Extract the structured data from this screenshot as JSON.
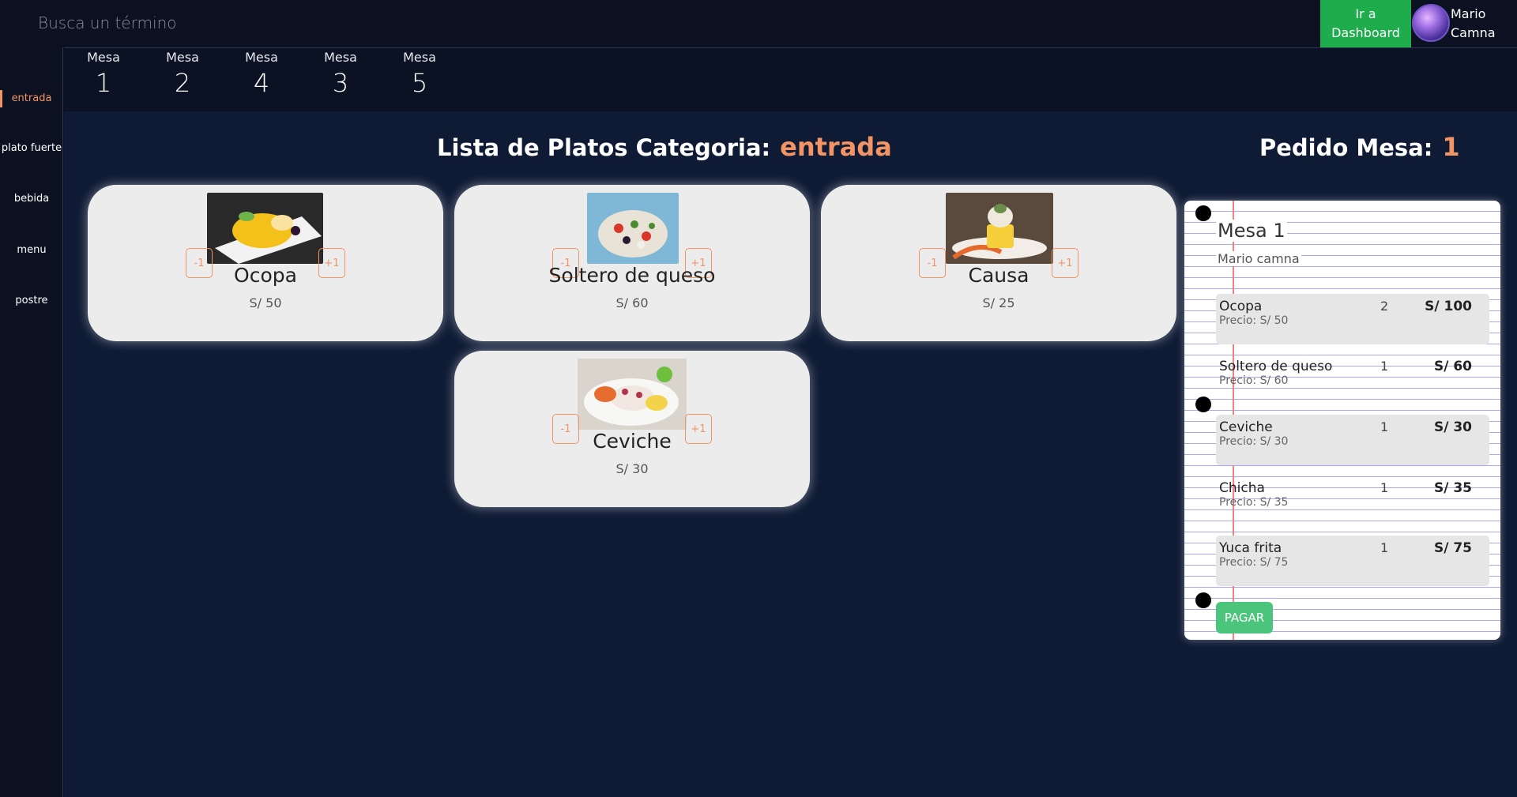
{
  "search": {
    "placeholder": "Busca un término"
  },
  "header": {
    "dashboard_button": "Ir a\nDashboard",
    "user_name": "Mario\nCamna",
    "accent_color": "#1eac4c"
  },
  "sidebar": {
    "items": [
      {
        "label": "entrada",
        "active": true
      },
      {
        "label": "plato fuerte",
        "active": false
      },
      {
        "label": "bebida",
        "active": false
      },
      {
        "label": "menu",
        "active": false
      },
      {
        "label": "postre",
        "active": false
      }
    ]
  },
  "mesas": [
    {
      "label": "Mesa",
      "number": "1"
    },
    {
      "label": "Mesa",
      "number": "2"
    },
    {
      "label": "Mesa",
      "number": "4"
    },
    {
      "label": "Mesa",
      "number": "3"
    },
    {
      "label": "Mesa",
      "number": "5"
    }
  ],
  "dishes_section": {
    "title": "Lista de Platos Categoria:",
    "category": "entrada",
    "dishes": [
      {
        "name": "Ocopa",
        "price": "S/ 50",
        "minus": "-1",
        "plus": "+1"
      },
      {
        "name": "Soltero de queso",
        "price": "S/ 60",
        "minus": "-1",
        "plus": "+1"
      },
      {
        "name": "Causa",
        "price": "S/ 25",
        "minus": "-1",
        "plus": "+1"
      },
      {
        "name": "Ceviche",
        "price": "S/ 30",
        "minus": "-1",
        "plus": "+1"
      }
    ]
  },
  "order": {
    "title": "Pedido Mesa:",
    "table_number": "1",
    "notebook_title": "Mesa 1",
    "waiter": "Mario camna",
    "items": [
      {
        "name": "Ocopa",
        "unit_price": "Precio: S/ 50",
        "qty": "2",
        "total": "S/ 100"
      },
      {
        "name": "Soltero de queso",
        "unit_price": "Precio: S/ 60",
        "qty": "1",
        "total": "S/ 60"
      },
      {
        "name": "Ceviche",
        "unit_price": "Precio: S/ 30",
        "qty": "1",
        "total": "S/ 30"
      },
      {
        "name": "Chicha",
        "unit_price": "Precio: S/ 35",
        "qty": "1",
        "total": "S/ 35"
      },
      {
        "name": "Yuca frita",
        "unit_price": "Precio: S/ 75",
        "qty": "1",
        "total": "S/ 75"
      }
    ],
    "pay_button": "PAGAR"
  },
  "colors": {
    "background": "#0b1120",
    "main_background": "#0f1b35",
    "accent_orange": "#f29463",
    "pay_green": "#4cc57c"
  }
}
